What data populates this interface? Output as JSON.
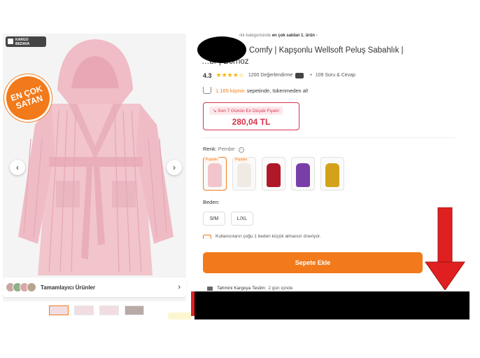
{
  "gallery": {
    "kargo_badge": "KARGO BEDAVA",
    "best_seller_line1": "EN ÇOK",
    "best_seller_line2": "SATAN",
    "prev_glyph": "‹",
    "next_glyph": "›",
    "complementary_label": "Tamamlayıcı Ürünler",
    "complementary_chevron": "›"
  },
  "product": {
    "category_crumb_prefix": "ılık kategorisinde ",
    "category_crumb_bold": "en çok satılan 1. ürün",
    "category_crumb_suffix": " ›",
    "title_line1": "Comfy | Kapşonlu Wellsoft Peluş Sabahlık |",
    "title_line2": "…br | Bornoz",
    "rating": "4.3",
    "stars": "★★★★☆",
    "reviews": "1200 Değerlendirme",
    "qa": "109 Soru & Cevap",
    "cart_count": "1.165 kişinin",
    "cart_text": "sepetinde, tükenmeden al!",
    "price_note": "Son 7 Günün En Düşük Fiyatı!",
    "price": "280,04 TL",
    "color_label": "Renk:",
    "color_selected": "Pembe",
    "size_label": "Beden:",
    "size_note": "Kullanıcıların çoğu 1 beden küçük almanızı öneriyor.",
    "add_to_cart": "Sepete Ekle",
    "shipping_label": "Tahmini Kargoya Teslim:",
    "shipping_days": "2 gün içinde"
  },
  "swatches": [
    {
      "color": "#f2c4cc",
      "popular": "Popüler",
      "selected": true
    },
    {
      "color": "#efebe4",
      "popular": "Popüler",
      "selected": false
    },
    {
      "color": "#b0182a",
      "popular": "",
      "selected": false
    },
    {
      "color": "#7a3ea8",
      "popular": "",
      "selected": false
    },
    {
      "color": "#d4a21a",
      "popular": "",
      "selected": false
    }
  ],
  "sizes": [
    "S/M",
    "L/XL"
  ],
  "colors": {
    "accent": "#f27a1a",
    "price_red": "#d9324a",
    "arrow_red": "#e02020",
    "robe_pink": "#f2c4cc"
  }
}
